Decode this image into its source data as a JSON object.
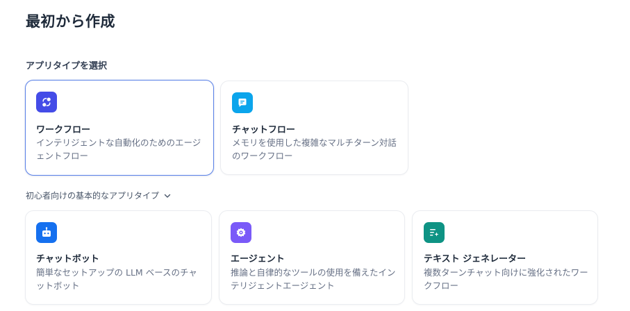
{
  "page": {
    "title": "最初から作成",
    "app_type_label": "アプリタイプを選択",
    "basic_types_toggle": "初心者向けの基本的なアプリタイプ"
  },
  "app_types": [
    {
      "id": "workflow",
      "name": "ワークフロー",
      "description": "インテリジェントな自動化のためのエージェントフロー",
      "icon": "workflow-icon",
      "icon_color": "#444ce7",
      "selected": true
    },
    {
      "id": "chatflow",
      "name": "チャットフロー",
      "description": "メモリを使用した複雑なマルチターン対話のワークフロー",
      "icon": "chatflow-icon",
      "icon_color": "#0ba5ec",
      "selected": false
    }
  ],
  "basic_types": [
    {
      "id": "chatbot",
      "name": "チャットボット",
      "description": "簡単なセットアップの LLM ベースのチャットボット",
      "icon": "chatbot-icon",
      "icon_color": "#1570ef"
    },
    {
      "id": "agent",
      "name": "エージェント",
      "description": "推論と自律的なツールの使用を備えたインテリジェントエージェント",
      "icon": "agent-icon",
      "icon_color": "#7a5af8"
    },
    {
      "id": "textgen",
      "name": "テキスト ジェネレーター",
      "description": "複数ターンチャット向けに強化されたワークフロー",
      "icon": "text-generator-icon",
      "icon_color": "#0e9384"
    }
  ],
  "colors": {
    "selected_border": "#5b82e8",
    "card_border": "#eaecf0"
  }
}
